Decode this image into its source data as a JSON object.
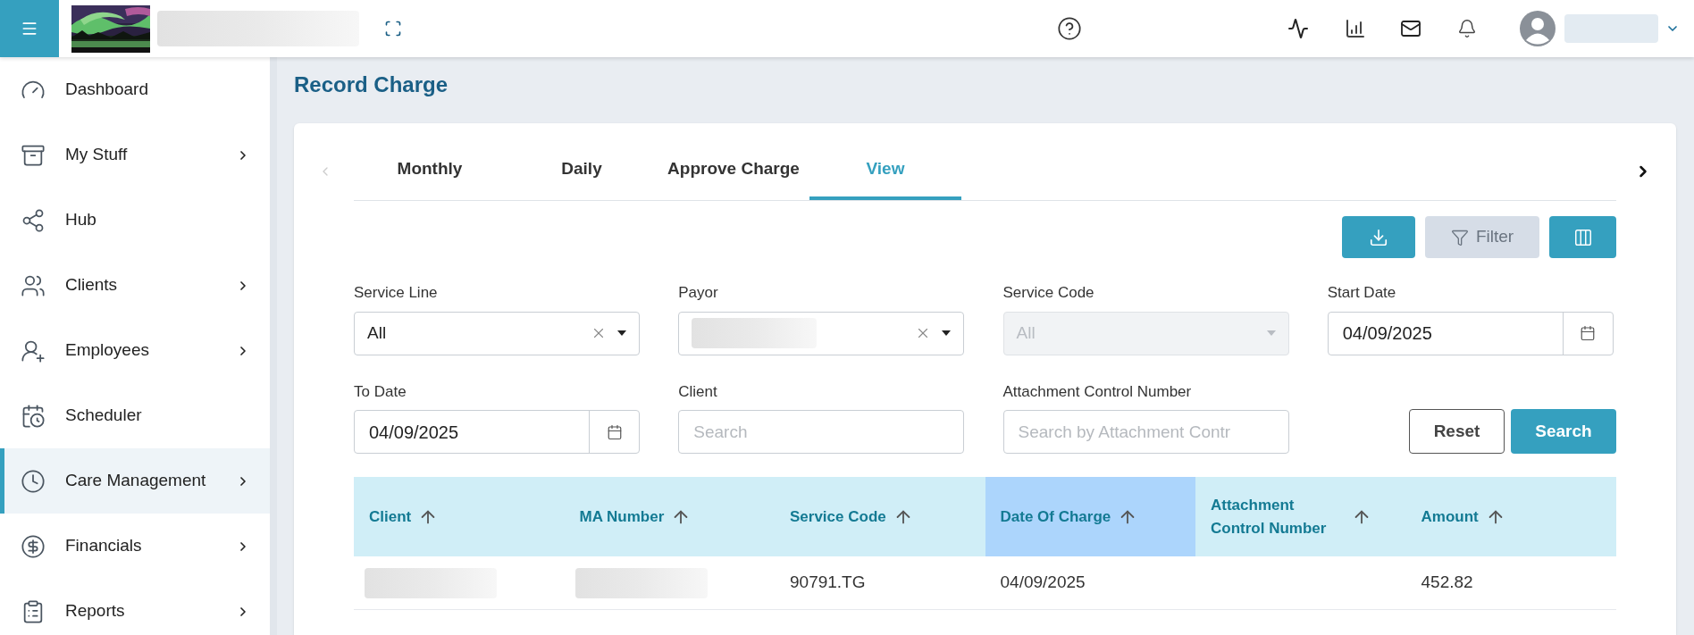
{
  "topbar": {
    "org_name": {
      "kind": "redacted"
    },
    "user_name": {
      "kind": "redacted"
    }
  },
  "sidebar": {
    "items": [
      {
        "label": "Dashboard",
        "has_submenu": false,
        "selected": false
      },
      {
        "label": "My Stuff",
        "has_submenu": true,
        "selected": false
      },
      {
        "label": "Hub",
        "has_submenu": false,
        "selected": false
      },
      {
        "label": "Clients",
        "has_submenu": true,
        "selected": false
      },
      {
        "label": "Employees",
        "has_submenu": true,
        "selected": false
      },
      {
        "label": "Scheduler",
        "has_submenu": false,
        "selected": false
      },
      {
        "label": "Care Management",
        "has_submenu": true,
        "selected": true
      },
      {
        "label": "Financials",
        "has_submenu": true,
        "selected": false
      },
      {
        "label": "Reports",
        "has_submenu": true,
        "selected": false
      }
    ]
  },
  "page": {
    "title": "Record Charge"
  },
  "tabs": [
    {
      "label": "Monthly",
      "selected": false
    },
    {
      "label": "Daily",
      "selected": false
    },
    {
      "label": "Approve Charge",
      "selected": false
    },
    {
      "label": "View",
      "selected": true
    }
  ],
  "toolbar": {
    "filter_label": "Filter"
  },
  "filters": [
    {
      "label": "Service Line",
      "kind": "select",
      "value": "All",
      "redacted": false,
      "clearable": true,
      "disabled": false
    },
    {
      "label": "Payor",
      "kind": "select",
      "redacted": true,
      "clearable": true,
      "disabled": false
    },
    {
      "label": "Service Code",
      "kind": "select",
      "value": "All",
      "redacted": false,
      "clearable": false,
      "disabled": true
    },
    {
      "label": "Start Date",
      "kind": "date",
      "value": "04/09/2025"
    },
    {
      "label": "To Date",
      "kind": "date",
      "value": "04/09/2025"
    },
    {
      "label": "Client",
      "kind": "text",
      "placeholder": "Search"
    },
    {
      "label": "Attachment Control Number",
      "kind": "text",
      "placeholder": "Search by Attachment Contr"
    }
  ],
  "actions": {
    "reset": "Reset",
    "search": "Search"
  },
  "table": {
    "columns": [
      {
        "label": "Client",
        "sorted": false
      },
      {
        "label": "MA Number",
        "sorted": false
      },
      {
        "label": "Service Code",
        "sorted": false
      },
      {
        "label": "Date Of Charge",
        "sorted": true
      },
      {
        "label": "Attachment Control Number",
        "sorted": false
      },
      {
        "label": "Amount",
        "sorted": false
      }
    ],
    "rows": [
      [
        {
          "kind": "redacted"
        },
        {
          "kind": "redacted"
        },
        {
          "kind": "text",
          "text": "90791.TG"
        },
        {
          "kind": "text",
          "text": "04/09/2025"
        },
        {
          "kind": "empty"
        },
        {
          "kind": "text",
          "text": "452.82"
        }
      ]
    ]
  }
}
